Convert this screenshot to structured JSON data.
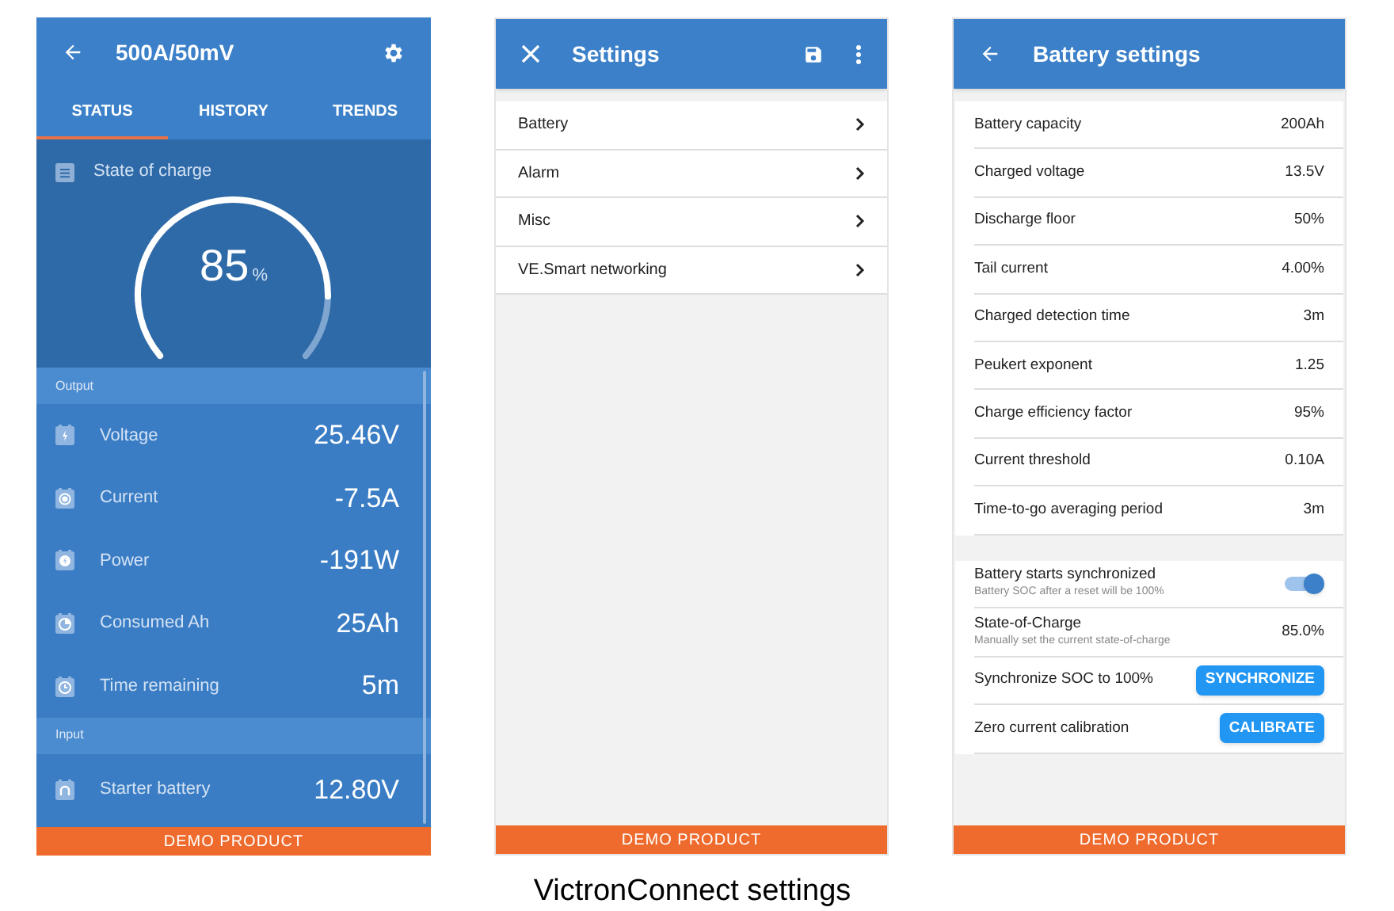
{
  "screens": [
    {
      "kind": "status",
      "header": {
        "title": "500A/50mV"
      },
      "tabs": [
        {
          "label": "STATUS",
          "selected": true
        },
        {
          "label": "HISTORY",
          "selected": false
        },
        {
          "label": "TRENDS",
          "selected": false
        }
      ],
      "soc": {
        "label": "State of charge",
        "value": "85",
        "unit": "%"
      },
      "sections": [
        {
          "title": "Output",
          "rows": [
            {
              "label": "Voltage",
              "value": "25.46V"
            },
            {
              "label": "Current",
              "value": "-7.5A"
            },
            {
              "label": "Power",
              "value": "-191W"
            },
            {
              "label": "Consumed Ah",
              "value": "25Ah"
            },
            {
              "label": "Time remaining",
              "value": "5m"
            }
          ]
        },
        {
          "title": "Input",
          "rows": [
            {
              "label": "Starter battery",
              "value": "12.80V"
            }
          ]
        }
      ],
      "footer": "DEMO PRODUCT"
    },
    {
      "kind": "menu",
      "header": {
        "title": "Settings"
      },
      "items": [
        {
          "label": "Battery"
        },
        {
          "label": "Alarm"
        },
        {
          "label": "Misc"
        },
        {
          "label": "VE.Smart networking"
        }
      ],
      "footer": "DEMO PRODUCT"
    },
    {
      "kind": "settings",
      "header": {
        "title": "Battery settings"
      },
      "rows": [
        {
          "label": "Battery capacity",
          "value": "200Ah"
        },
        {
          "label": "Charged voltage",
          "value": "13.5V"
        },
        {
          "label": "Discharge floor",
          "value": "50%"
        },
        {
          "label": "Tail current",
          "value": "4.00%"
        },
        {
          "label": "Charged detection time",
          "value": "3m"
        },
        {
          "label": "Peukert exponent",
          "value": "1.25"
        },
        {
          "label": "Charge efficiency factor",
          "value": "95%"
        },
        {
          "label": "Current threshold",
          "value": "0.10A"
        },
        {
          "label": "Time-to-go averaging period",
          "value": "3m"
        }
      ],
      "options": [
        {
          "kind": "toggle",
          "label": "Battery starts synchronized",
          "description": "Battery SOC after a reset will be 100%",
          "on": true
        },
        {
          "kind": "value",
          "label": "State-of-Charge",
          "description": "Manually set the current state-of-charge",
          "value": "85.0%"
        },
        {
          "kind": "button",
          "label": "Synchronize SOC to 100%",
          "button": "SYNCHRONIZE"
        },
        {
          "kind": "button",
          "label": "Zero current calibration",
          "button": "CALIBRATE"
        }
      ],
      "footer": "DEMO PRODUCT"
    }
  ],
  "caption": "VictronConnect settings"
}
